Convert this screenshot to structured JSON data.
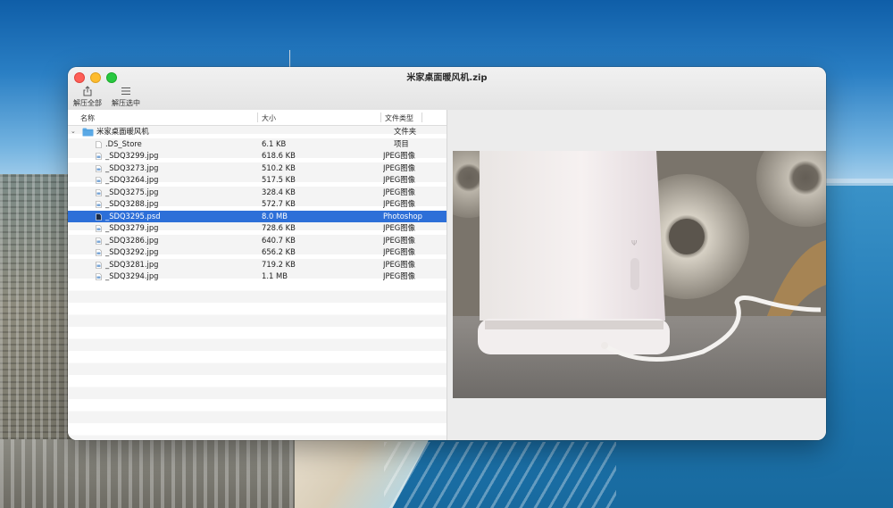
{
  "window": {
    "title": "米家桌面暖风机.zip"
  },
  "toolbar": {
    "extract_all_label": "解压全部",
    "extract_selected_label": "解压选中"
  },
  "columns": {
    "name": "名称",
    "size": "大小",
    "kind": "文件类型"
  },
  "folder": {
    "name": "米家桌面暖风机",
    "kind": "文件夹",
    "expanded": true
  },
  "files": [
    {
      "name": ".DS_Store",
      "size": "6.1 KB",
      "kind": "项目",
      "icon": "blank-file-icon"
    },
    {
      "name": "_SDQ3299.jpg",
      "size": "618.6 KB",
      "kind": "JPEG图像",
      "icon": "jpeg-file-icon"
    },
    {
      "name": "_SDQ3273.jpg",
      "size": "510.2 KB",
      "kind": "JPEG图像",
      "icon": "jpeg-file-icon"
    },
    {
      "name": "_SDQ3264.jpg",
      "size": "517.5 KB",
      "kind": "JPEG图像",
      "icon": "jpeg-file-icon"
    },
    {
      "name": "_SDQ3275.jpg",
      "size": "328.4 KB",
      "kind": "JPEG图像",
      "icon": "jpeg-file-icon"
    },
    {
      "name": "_SDQ3288.jpg",
      "size": "572.7 KB",
      "kind": "JPEG图像",
      "icon": "jpeg-file-icon"
    },
    {
      "name": "_SDQ3295.psd",
      "size": "8.0 MB",
      "kind": "Photoshop",
      "icon": "psd-file-icon",
      "selected": true
    },
    {
      "name": "_SDQ3279.jpg",
      "size": "728.6 KB",
      "kind": "JPEG图像",
      "icon": "jpeg-file-icon"
    },
    {
      "name": "_SDQ3286.jpg",
      "size": "640.7 KB",
      "kind": "JPEG图像",
      "icon": "jpeg-file-icon"
    },
    {
      "name": "_SDQ3292.jpg",
      "size": "656.2 KB",
      "kind": "JPEG图像",
      "icon": "jpeg-file-icon"
    },
    {
      "name": "_SDQ3281.jpg",
      "size": "719.2 KB",
      "kind": "JPEG图像",
      "icon": "jpeg-file-icon"
    },
    {
      "name": "_SDQ3294.jpg",
      "size": "1.1 MB",
      "kind": "JPEG图像",
      "icon": "jpeg-file-icon"
    }
  ],
  "colors": {
    "selection": "#2d6fd8",
    "close": "#fe5f57",
    "minimize": "#febc2e",
    "zoom": "#28c840",
    "folder": "#5aa9e6"
  }
}
